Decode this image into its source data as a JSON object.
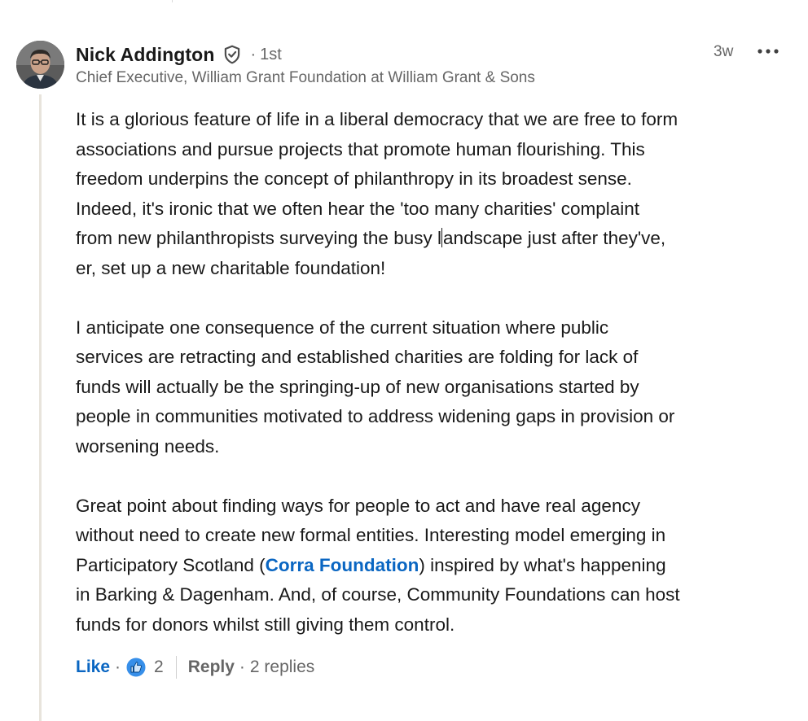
{
  "comment": {
    "author": {
      "name": "Nick Addington",
      "degree": "1st",
      "headline": "Chief Executive, William Grant Foundation at William Grant & Sons"
    },
    "timestamp": "3w",
    "paragraphs": {
      "p1_before_caret": "It is a glorious feature of life in a liberal democracy that we are free to form\nassociations and pursue projects that promote human flourishing. This\nfreedom underpins the concept of philanthropy in its broadest sense.\nIndeed, it's ironic that we often hear the 'too many charities' complaint\nfrom new philanthropists surveying the busy l",
      "p1_after_caret": "andscape just after they've,\ner, set up a new charitable foundation!",
      "p2": "I anticipate one consequence of the current situation where public\nservices are retracting and established charities are folding for lack of\nfunds will actually be the springing-up of new organisations started by\npeople in communities motivated to address widening gaps in provision or\nworsening needs.",
      "p3_before_link": "Great point about finding ways for people to act and have real agency\nwithout need to create new formal entities. Interesting model emerging in\nParticipatory Scotland (",
      "p3_link": "Corra Foundation",
      "p3_after_link": ") inspired by what's happening\nin Barking & Dagenham. And, of course, Community Foundations can host\nfunds for donors whilst still giving them control."
    },
    "actions": {
      "like_label": "Like",
      "reaction_count": "2",
      "reply_label": "Reply",
      "replies_label": "2 replies"
    }
  },
  "icons": {
    "verified": "shield-check-icon",
    "more": "ellipsis-icon",
    "reaction": "thumbs-up-reaction-icon"
  },
  "colors": {
    "link_blue": "#0a66c2",
    "secondary_text": "#666666",
    "primary_text": "#191919",
    "thread_line": "#e8e4dc"
  }
}
